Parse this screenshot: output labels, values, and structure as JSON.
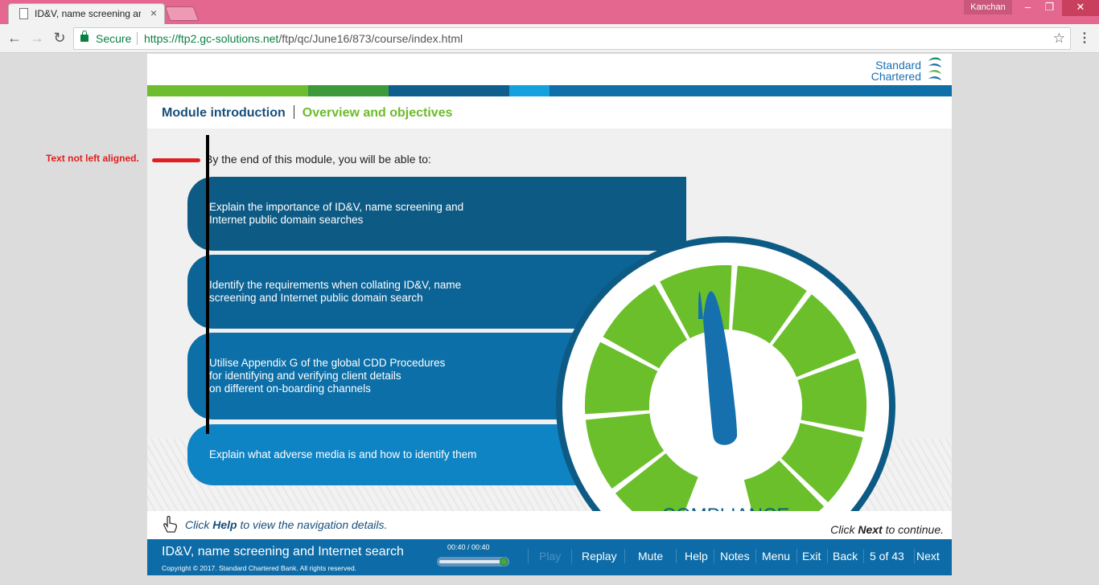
{
  "browser": {
    "tab_title": "ID&V, name screening ar",
    "tab_close": "×",
    "user": "Kanchan",
    "secure_label": "Secure",
    "url_host": "https://ftp2.gc-solutions.net",
    "url_path": "/ftp/qc/June16/873/course/index.html",
    "window_controls": [
      "–",
      "❐",
      "✕"
    ]
  },
  "course": {
    "brand_line1": "Standard",
    "brand_line2": "Chartered",
    "stripe_colors": [
      "#6ebd2f",
      "#3c9a3b",
      "#0e5f8e",
      "#14a1de",
      "#0f6fa8"
    ],
    "breadcrumb": {
      "module": "Module introduction",
      "section": "Overview and objectives"
    },
    "intro": "By the end of this module, you will be able to:",
    "objectives": [
      {
        "text": "Explain the importance of ID&V, name screening and\nInternet public domain searches",
        "color": "#0d5b85"
      },
      {
        "text": "Identify the requirements when collating ID&V, name\nscreening and Internet public domain search",
        "color": "#0c6395"
      },
      {
        "text": "Utilise Appendix G of the global CDD Procedures\nfor identifying and verifying client details\non different on-boarding channels",
        "color": "#0c6fa8"
      },
      {
        "text": "Explain what adverse media is and how to identify them",
        "color": "#0f84c4"
      }
    ],
    "gauge_label": "COMPLIANCE",
    "annotation": "Text not left aligned.",
    "help": {
      "pre": "Click ",
      "bold": "Help",
      "post": " to view the navigation details."
    },
    "next_hint": {
      "pre": "Click ",
      "bold": "Next",
      "post": " to continue."
    },
    "footer": {
      "title": "ID&V, name screening and Internet search",
      "copyright": "Copyright © 2017. Standard Chartered Bank. All rights reserved.",
      "timer": "00:40 / 00:40",
      "progress": 1.0,
      "nav": {
        "play": "Play",
        "replay": "Replay",
        "mute": "Mute",
        "help": "Help",
        "notes": "Notes",
        "menu": "Menu",
        "exit": "Exit",
        "back": "Back",
        "page": "5 of 43",
        "next": "Next"
      }
    }
  }
}
